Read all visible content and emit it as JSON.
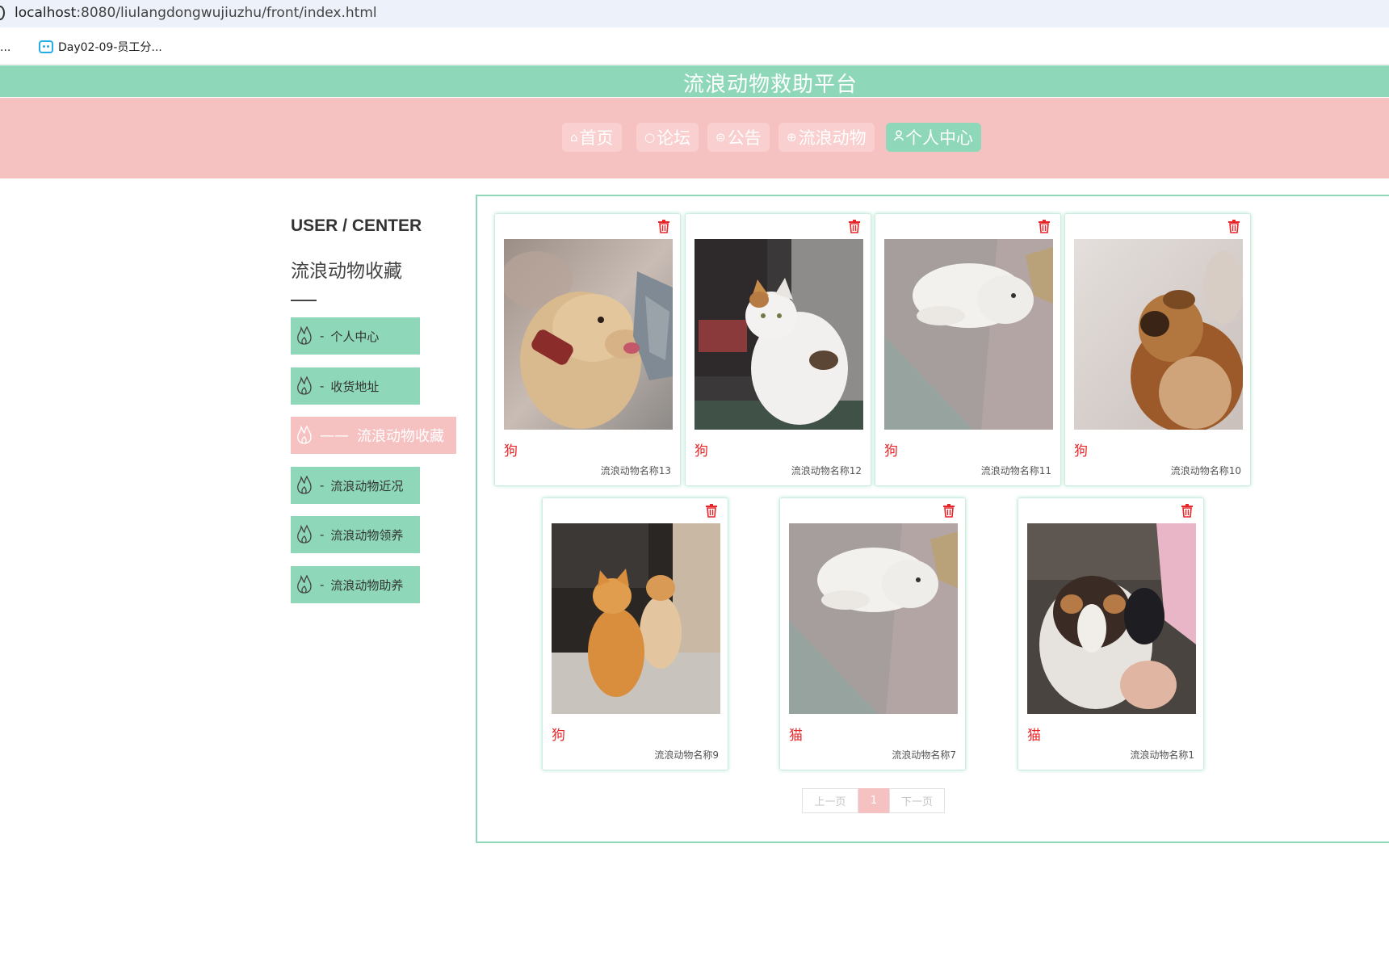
{
  "browser": {
    "url_host": "localhost",
    "url_rest": ":8080/liulangdongwujiuzhu/front/index.html",
    "bookmark_left": "组...",
    "bookmark_main": "Day02-09-员工分..."
  },
  "header": {
    "title": "流浪动物救助平台",
    "nav": [
      {
        "icon": "⌂",
        "label": "首页"
      },
      {
        "icon": "○",
        "label": "论坛"
      },
      {
        "icon": "⊜",
        "label": "公告"
      },
      {
        "icon": "⊕",
        "label": "流浪动物"
      },
      {
        "icon": "ᴥ",
        "label": "个人中心"
      }
    ]
  },
  "sidebar": {
    "heading": "USER / CENTER",
    "subtitle": "流浪动物收藏",
    "items": [
      {
        "sep": "-",
        "label": "个人中心"
      },
      {
        "sep": "-",
        "label": "收货地址"
      },
      {
        "sep": "——",
        "label": "流浪动物收藏"
      },
      {
        "sep": "-",
        "label": "流浪动物近况"
      },
      {
        "sep": "-",
        "label": "流浪动物领养"
      },
      {
        "sep": "-",
        "label": "流浪动物助养"
      }
    ]
  },
  "favorites": [
    {
      "type": "狗",
      "name": "流浪动物名称13"
    },
    {
      "type": "狗",
      "name": "流浪动物名称12"
    },
    {
      "type": "狗",
      "name": "流浪动物名称11"
    },
    {
      "type": "狗",
      "name": "流浪动物名称10"
    },
    {
      "type": "狗",
      "name": "流浪动物名称9"
    },
    {
      "type": "猫",
      "name": "流浪动物名称7"
    },
    {
      "type": "猫",
      "name": "流浪动物名称1"
    }
  ],
  "pagination": {
    "prev": "上一页",
    "current": "1",
    "next": "下一页"
  },
  "colors": {
    "mint": "#8ed8b9",
    "pink": "#f6c1c1",
    "red": "#e8262a"
  }
}
